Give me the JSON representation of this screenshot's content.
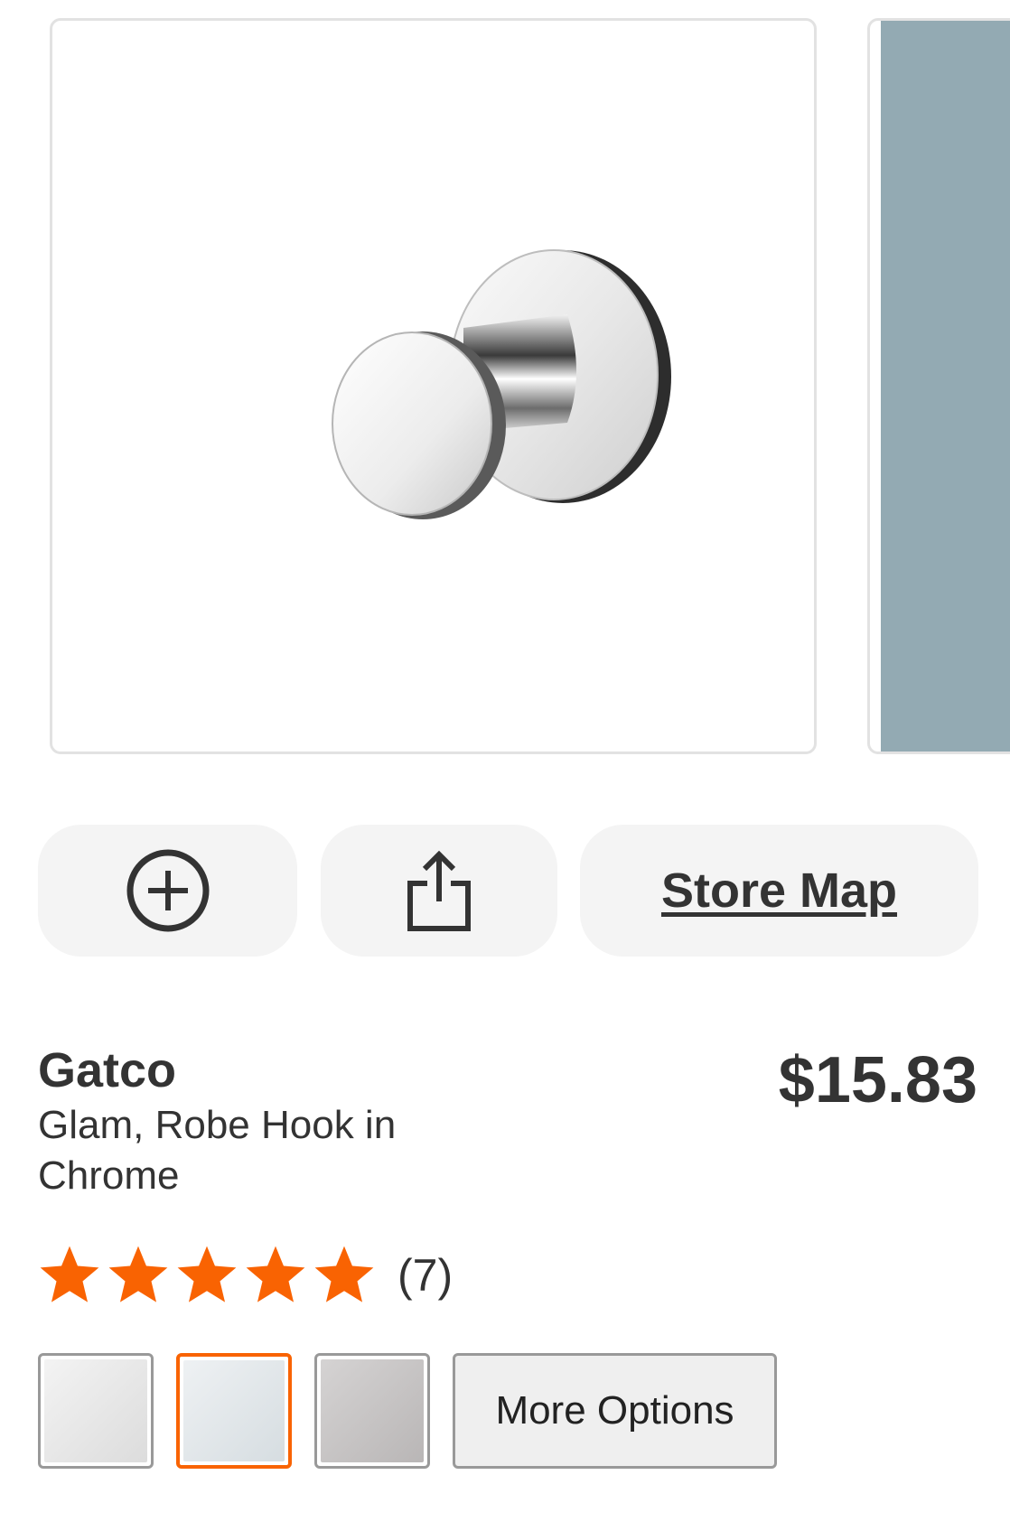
{
  "gallery": {
    "main_image": "product-photo-robe-hook",
    "next_image": "product-photo-next-partial"
  },
  "actions": {
    "add_icon": "plus-circle-icon",
    "share_icon": "share-icon",
    "store_map_label": "Store Map"
  },
  "product": {
    "brand": "Gatco",
    "name": "Glam, Robe Hook in Chrome",
    "price": "$15.83"
  },
  "rating": {
    "stars": 5,
    "review_count": "(7)",
    "star_color": "#f96302"
  },
  "options": {
    "swatches": [
      {
        "name": "swatch-1",
        "selected": false
      },
      {
        "name": "swatch-2",
        "selected": true
      },
      {
        "name": "swatch-3",
        "selected": false
      }
    ],
    "more_options_label": "More Options"
  },
  "colors": {
    "accent": "#f96302",
    "button_bg": "#f4f4f4",
    "text": "#333333"
  }
}
